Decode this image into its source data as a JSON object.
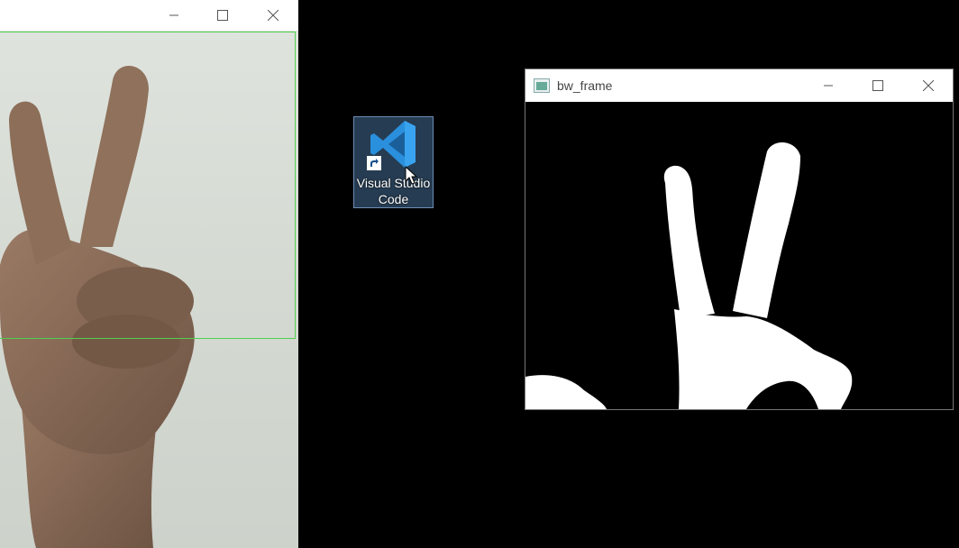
{
  "camera_window": {
    "controls": {
      "minimize": "minimize-icon",
      "maximize": "maximize-icon",
      "close": "close-icon"
    },
    "roi_color": "#4fd14f"
  },
  "bw_window": {
    "title": "bw_frame",
    "controls": {
      "minimize": "minimize-icon",
      "maximize": "maximize-icon",
      "close": "close-icon"
    }
  },
  "desktop": {
    "shortcut": {
      "label": "Visual Studio Code",
      "icon": "vscode-icon"
    }
  },
  "colors": {
    "desktop_bg": "#000000",
    "vscode_blue": "#1f8ad2"
  }
}
